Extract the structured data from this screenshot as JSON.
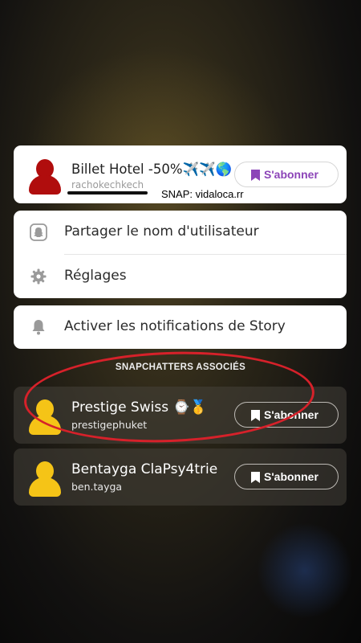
{
  "profile": {
    "name": "Billet Hotel -50%✈️✈️🌎",
    "username": "rachokechkech",
    "subscribe_label": "S'abonner"
  },
  "caption": "SNAP: vidaloca.rr",
  "menu": {
    "share_label": "Partager le nom d'utilisateur",
    "settings_label": "Réglages",
    "notifications_label": "Activer les notifications de Story"
  },
  "related": {
    "title": "SNAPCHATTERS ASSOCIÉS",
    "items": [
      {
        "name": "Prestige Swiss ⌚🥇",
        "username": "prestigephuket",
        "subscribe_label": "S'abonner"
      },
      {
        "name": "Bentayga ClaPsy4trie",
        "username": "ben.tayga",
        "subscribe_label": "S'abonner"
      }
    ]
  },
  "colors": {
    "accent": "#8c44b8",
    "avatar_profile": "#b00d0d",
    "avatar_related": "#f5c417",
    "annotation": "#d6212a"
  },
  "icons": [
    "snapchat-ghost-icon",
    "gear-icon",
    "bell-icon",
    "bookmark-icon"
  ]
}
